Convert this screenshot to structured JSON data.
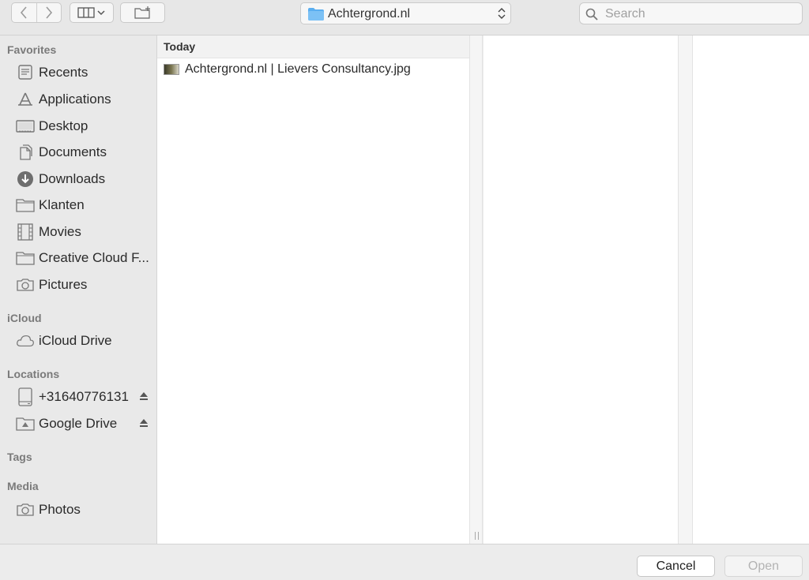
{
  "toolbar": {
    "location": "Achtergrond.nl",
    "search_placeholder": "Search"
  },
  "sidebar": {
    "favorites_label": "Favorites",
    "favorites": [
      {
        "label": "Recents",
        "icon": "clock-icon"
      },
      {
        "label": "Applications",
        "icon": "applications-icon"
      },
      {
        "label": "Desktop",
        "icon": "desktop-icon"
      },
      {
        "label": "Documents",
        "icon": "documents-icon"
      },
      {
        "label": "Downloads",
        "icon": "downloads-icon"
      },
      {
        "label": "Klanten",
        "icon": "folder-icon"
      },
      {
        "label": "Movies",
        "icon": "movies-icon"
      },
      {
        "label": "Creative Cloud F...",
        "icon": "folder-icon"
      },
      {
        "label": "Pictures",
        "icon": "camera-icon"
      }
    ],
    "icloud_label": "iCloud",
    "icloud": [
      {
        "label": "iCloud Drive",
        "icon": "cloud-icon"
      }
    ],
    "locations_label": "Locations",
    "locations": [
      {
        "label": "+31640776131",
        "icon": "drive-icon"
      },
      {
        "label": "Google Drive",
        "icon": "google-drive-folder-icon"
      }
    ],
    "tags_label": "Tags",
    "media_label": "Media",
    "media": [
      {
        "label": "Photos",
        "icon": "camera-icon"
      }
    ]
  },
  "browser": {
    "section_header": "Today",
    "files": [
      {
        "name": "Achtergrond.nl | Lievers Consultancy.jpg",
        "icon": "image-thumbnail-icon"
      }
    ]
  },
  "footer": {
    "cancel_label": "Cancel",
    "open_label": "Open"
  },
  "colors": {
    "toolbar_bg": "#e7e7e7",
    "sidebar_bg": "#e9e9e9",
    "folder_blue": "#5aaef0",
    "disabled_text": "#b3b3b3"
  }
}
